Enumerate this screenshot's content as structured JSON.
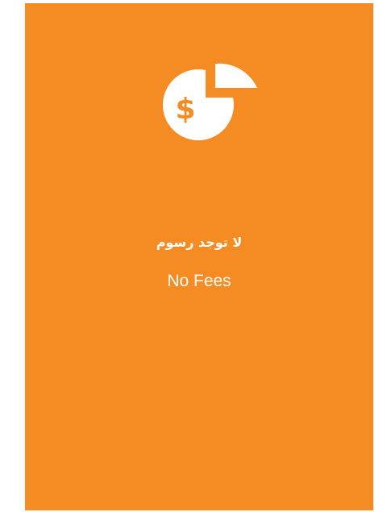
{
  "colors": {
    "card_background": "#f48b23",
    "foreground": "#ffffff",
    "page_background": "#ffffff"
  },
  "card": {
    "icon": "pie-chart-dollar-icon",
    "title_arabic": "لا توجد رسوم",
    "title_english": "No Fees"
  }
}
